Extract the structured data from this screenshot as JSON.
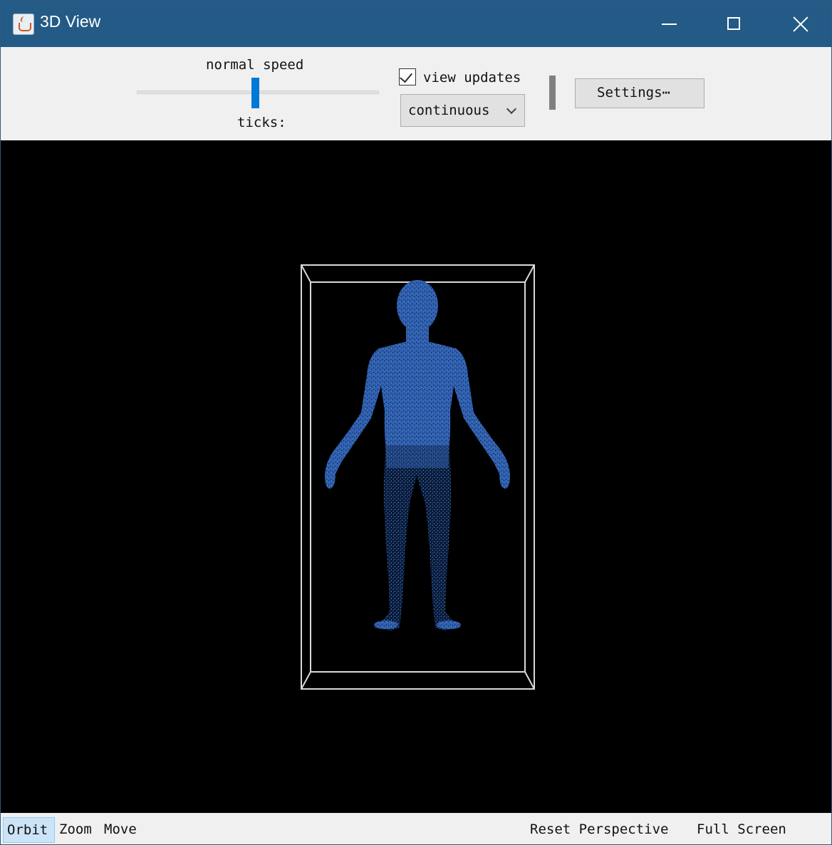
{
  "window": {
    "title": "3D View",
    "controls": {
      "minimize": "minimize-icon",
      "maximize": "maximize-icon",
      "close": "close-icon"
    }
  },
  "toolbar": {
    "speed_label": "normal speed",
    "ticks_label": "ticks:",
    "view_updates": {
      "label": "view updates",
      "checked": true
    },
    "update_mode": {
      "selected": "continuous"
    },
    "settings_label": "Settings⋯"
  },
  "viewport": {
    "background": "#000000",
    "box_color": "#d9d9d9",
    "figure_color": "#2f5fae"
  },
  "bottombar": {
    "modes": [
      "Orbit",
      "Zoom",
      "Move"
    ],
    "active_mode": "Orbit",
    "reset_label": "Reset Perspective",
    "fullscreen_label": "Full Screen"
  }
}
